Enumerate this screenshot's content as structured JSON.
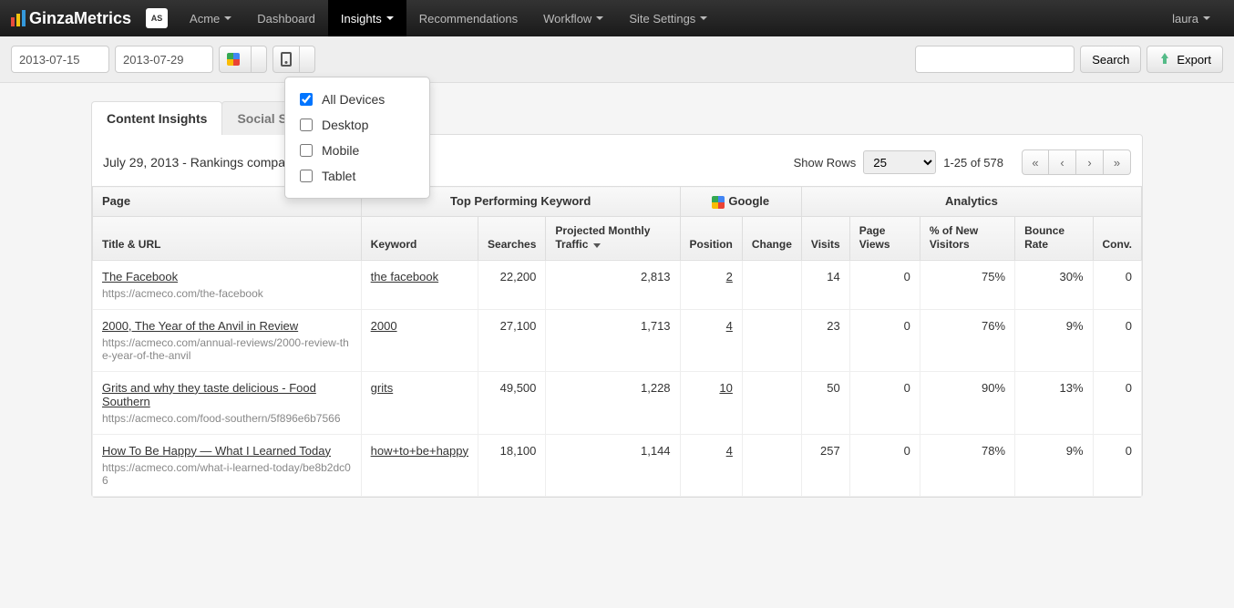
{
  "brand": "GinzaMetrics",
  "account_label": "Acme",
  "nav": {
    "dashboard": "Dashboard",
    "insights": "Insights",
    "recommendations": "Recommendations",
    "workflow": "Workflow",
    "site_settings": "Site Settings"
  },
  "user": "laura",
  "toolbar": {
    "date_from": "2013-07-15",
    "date_to": "2013-07-29",
    "search_btn": "Search",
    "export_btn": "Export"
  },
  "device_menu": {
    "all": "All Devices",
    "desktop": "Desktop",
    "mobile": "Mobile",
    "tablet": "Tablet"
  },
  "tabs": {
    "content": "Content Insights",
    "social": "Social Signals"
  },
  "summary_line": "July 29, 2013 - Rankings compa",
  "show_rows_label": "Show Rows",
  "rows_value": "25",
  "range_label": "1-25 of 578",
  "thead": {
    "page": "Page",
    "top_kw": "Top Performing Keyword",
    "google": "Google",
    "analytics": "Analytics",
    "title_url": "Title & URL",
    "keyword": "Keyword",
    "searches": "Searches",
    "projected": "Projected Monthly Traffic",
    "position": "Position",
    "change": "Change",
    "visits": "Visits",
    "page_views": "Page Views",
    "new_visitors": "% of New Visitors",
    "bounce": "Bounce Rate",
    "conv": "Conv."
  },
  "rows": [
    {
      "title": "The Facebook",
      "url": "https://acmeco.com/the-facebook",
      "keyword": "the facebook",
      "searches": "22,200",
      "projected": "2,813",
      "position": "2",
      "change": "",
      "visits": "14",
      "pv": "0",
      "newv": "75%",
      "bounce": "30%",
      "conv": "0"
    },
    {
      "title": "2000, The Year of the Anvil in Review",
      "url": "https://acmeco.com/annual-reviews/2000-review-the-year-of-the-anvil",
      "keyword": "2000",
      "searches": "27,100",
      "projected": "1,713",
      "position": "4",
      "change": "",
      "visits": "23",
      "pv": "0",
      "newv": "76%",
      "bounce": "9%",
      "conv": "0"
    },
    {
      "title": "Grits and why they taste delicious - Food Southern",
      "url": "https://acmeco.com/food-southern/5f896e6b7566",
      "keyword": "grits",
      "searches": "49,500",
      "projected": "1,228",
      "position": "10",
      "change": "",
      "visits": "50",
      "pv": "0",
      "newv": "90%",
      "bounce": "13%",
      "conv": "0"
    },
    {
      "title": "How To Be Happy — What I Learned Today",
      "url": "https://acmeco.com/what-i-learned-today/be8b2dc06",
      "keyword": "how+to+be+happy",
      "searches": "18,100",
      "projected": "1,144",
      "position": "4",
      "change": "",
      "visits": "257",
      "pv": "0",
      "newv": "78%",
      "bounce": "9%",
      "conv": "0"
    }
  ]
}
